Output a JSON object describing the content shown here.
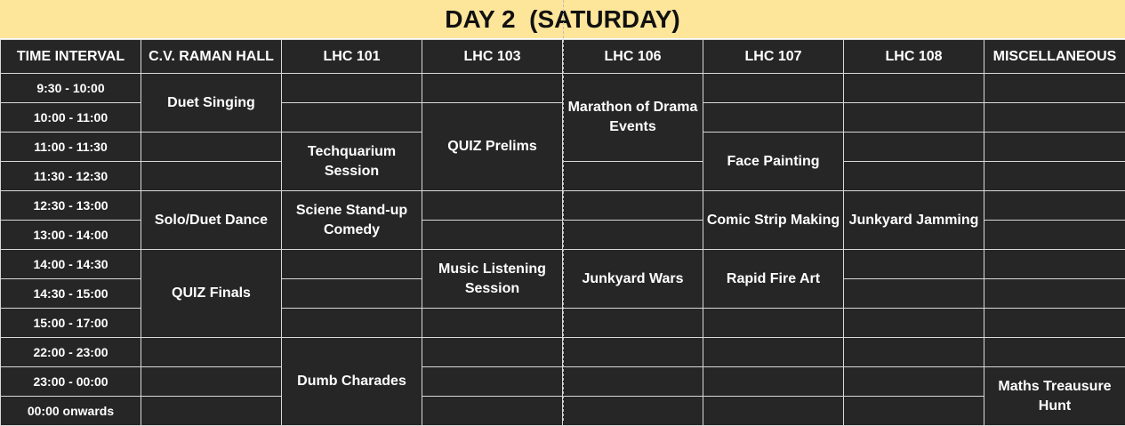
{
  "title": "DAY 2  (SATURDAY)",
  "columns": [
    "TIME INTERVAL",
    "C.V. RAMAN HALL",
    "LHC 101",
    "LHC 103",
    "LHC 106",
    "LHC 107",
    "LHC 108",
    "MISCELLANEOUS"
  ],
  "times": [
    "9:30 - 10:00",
    "10:00 - 11:00",
    "11:00 - 11:30",
    "11:30 - 12:30",
    "12:30 - 13:00",
    "13:00 - 14:00",
    "14:00 - 14:30",
    "14:30 - 15:00",
    "15:00 - 17:00",
    "22:00 - 23:00",
    "23:00 - 00:00",
    "00:00 onwards"
  ],
  "events": {
    "duet_singing": "Duet Singing",
    "solo_duet_dance": "Solo/Duet Dance",
    "quiz_finals": "QUIZ Finals",
    "techquarium": "Techquarium Session",
    "science_standup": "Sciene Stand-up Comedy",
    "dumb_charades": "Dumb Charades",
    "quiz_prelims": "QUIZ Prelims",
    "music_listening": "Music Listening Session",
    "marathon_drama": "Marathon of Drama Events",
    "junkyard_wars": "Junkyard Wars",
    "face_painting": "Face Painting",
    "comic_strip": "Comic Strip Making",
    "rapid_fire_art": "Rapid Fire Art",
    "junkyard_jamming": "Junkyard Jamming",
    "maths_hunt": "Maths Treausure Hunt"
  }
}
